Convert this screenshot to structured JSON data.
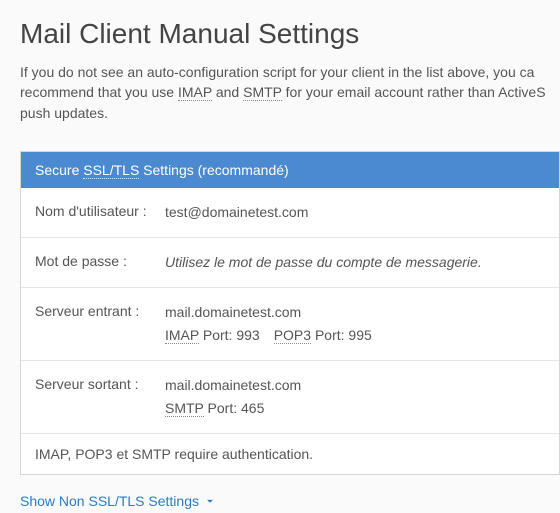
{
  "heading": "Mail Client Manual Settings",
  "intro": {
    "pre": "If you do not see an auto-configuration script for your client in the list above, you ca recommend that you use ",
    "imap": "IMAP",
    "mid": " and ",
    "smtp": "SMTP",
    "post": " for your email account rather than ActiveS push updates."
  },
  "panel": {
    "header": {
      "pre": "Secure ",
      "ssltls": "SSL/TLS",
      "post": " Settings (recommandé)"
    },
    "rows": {
      "username": {
        "label": "Nom d'utilisateur :",
        "value": "test@domainetest.com"
      },
      "password": {
        "label": "Mot de passe :",
        "value": "Utilisez le mot de passe du compte de messagerie."
      },
      "incoming": {
        "label": "Serveur entrant :",
        "host": "mail.domainetest.com",
        "imap_abbr": "IMAP",
        "imap_port_label": " Port: ",
        "imap_port": "993",
        "pop3_abbr": "POP3",
        "pop3_port_label": " Port: ",
        "pop3_port": "995"
      },
      "outgoing": {
        "label": "Serveur sortant :",
        "host": "mail.domainetest.com",
        "smtp_abbr": "SMTP",
        "smtp_port_label": " Port: ",
        "smtp_port": "465"
      }
    },
    "footnote": "IMAP, POP3 et SMTP require authentication."
  },
  "toggle_label": "Show Non SSL/TLS Settings"
}
